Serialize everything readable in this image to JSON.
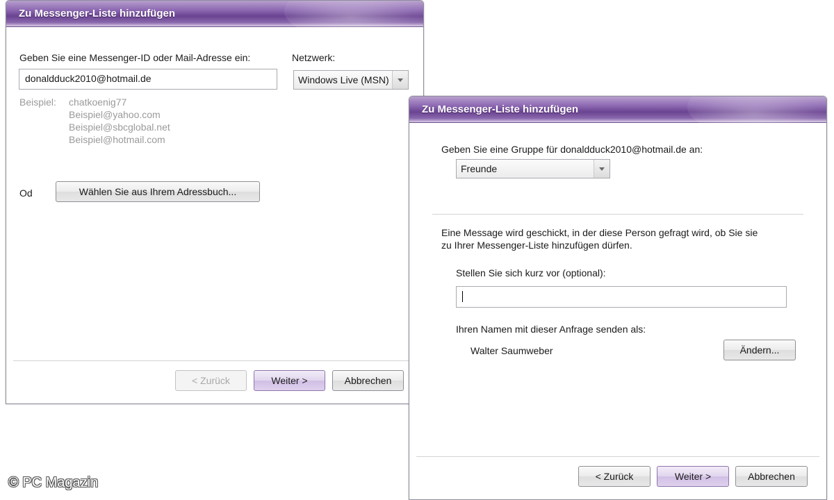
{
  "dialog1": {
    "title": "Zu Messenger-Liste hinzufügen",
    "id_prompt": "Geben Sie eine Messenger-ID oder Mail-Adresse ein:",
    "network_label": "Netzwerk:",
    "id_value": "donaldduck2010@hotmail.de",
    "network_selected": "Windows Live (MSN)",
    "example_label": "Beispiel:",
    "examples": [
      "chatkoenig77",
      "Beispiel@yahoo.com",
      "Beispiel@sbcglobal.net",
      "Beispiel@hotmail.com"
    ],
    "or_label": "Od",
    "addressbook_button": "Wählen Sie aus Ihrem Adressbuch...",
    "back_button": "< Zurück",
    "next_button": "Weiter >",
    "cancel_button": "Abbrechen"
  },
  "dialog2": {
    "title": "Zu Messenger-Liste hinzufügen",
    "group_prompt": "Geben Sie eine Gruppe für donaldduck2010@hotmail.de an:",
    "group_selected": "Freunde",
    "info_line1": "Eine Message wird geschickt, in der diese Person gefragt wird, ob Sie sie",
    "info_line2": "zu Ihrer Messenger-Liste hinzufügen dürfen.",
    "intro_label": "Stellen Sie sich kurz vor (optional):",
    "intro_value": "",
    "send_as_label": "Ihren Namen mit dieser Anfrage senden als:",
    "sender_name": "Walter Saumweber",
    "change_button": "Ändern...",
    "back_button": "< Zurück",
    "next_button": "Weiter >",
    "cancel_button": "Abbrechen"
  },
  "watermark": "© PC Magazin",
  "colors": {
    "titlebar": "#6a4391",
    "default_button": "#e1d5ee",
    "hint_text": "#9a9a9a"
  }
}
